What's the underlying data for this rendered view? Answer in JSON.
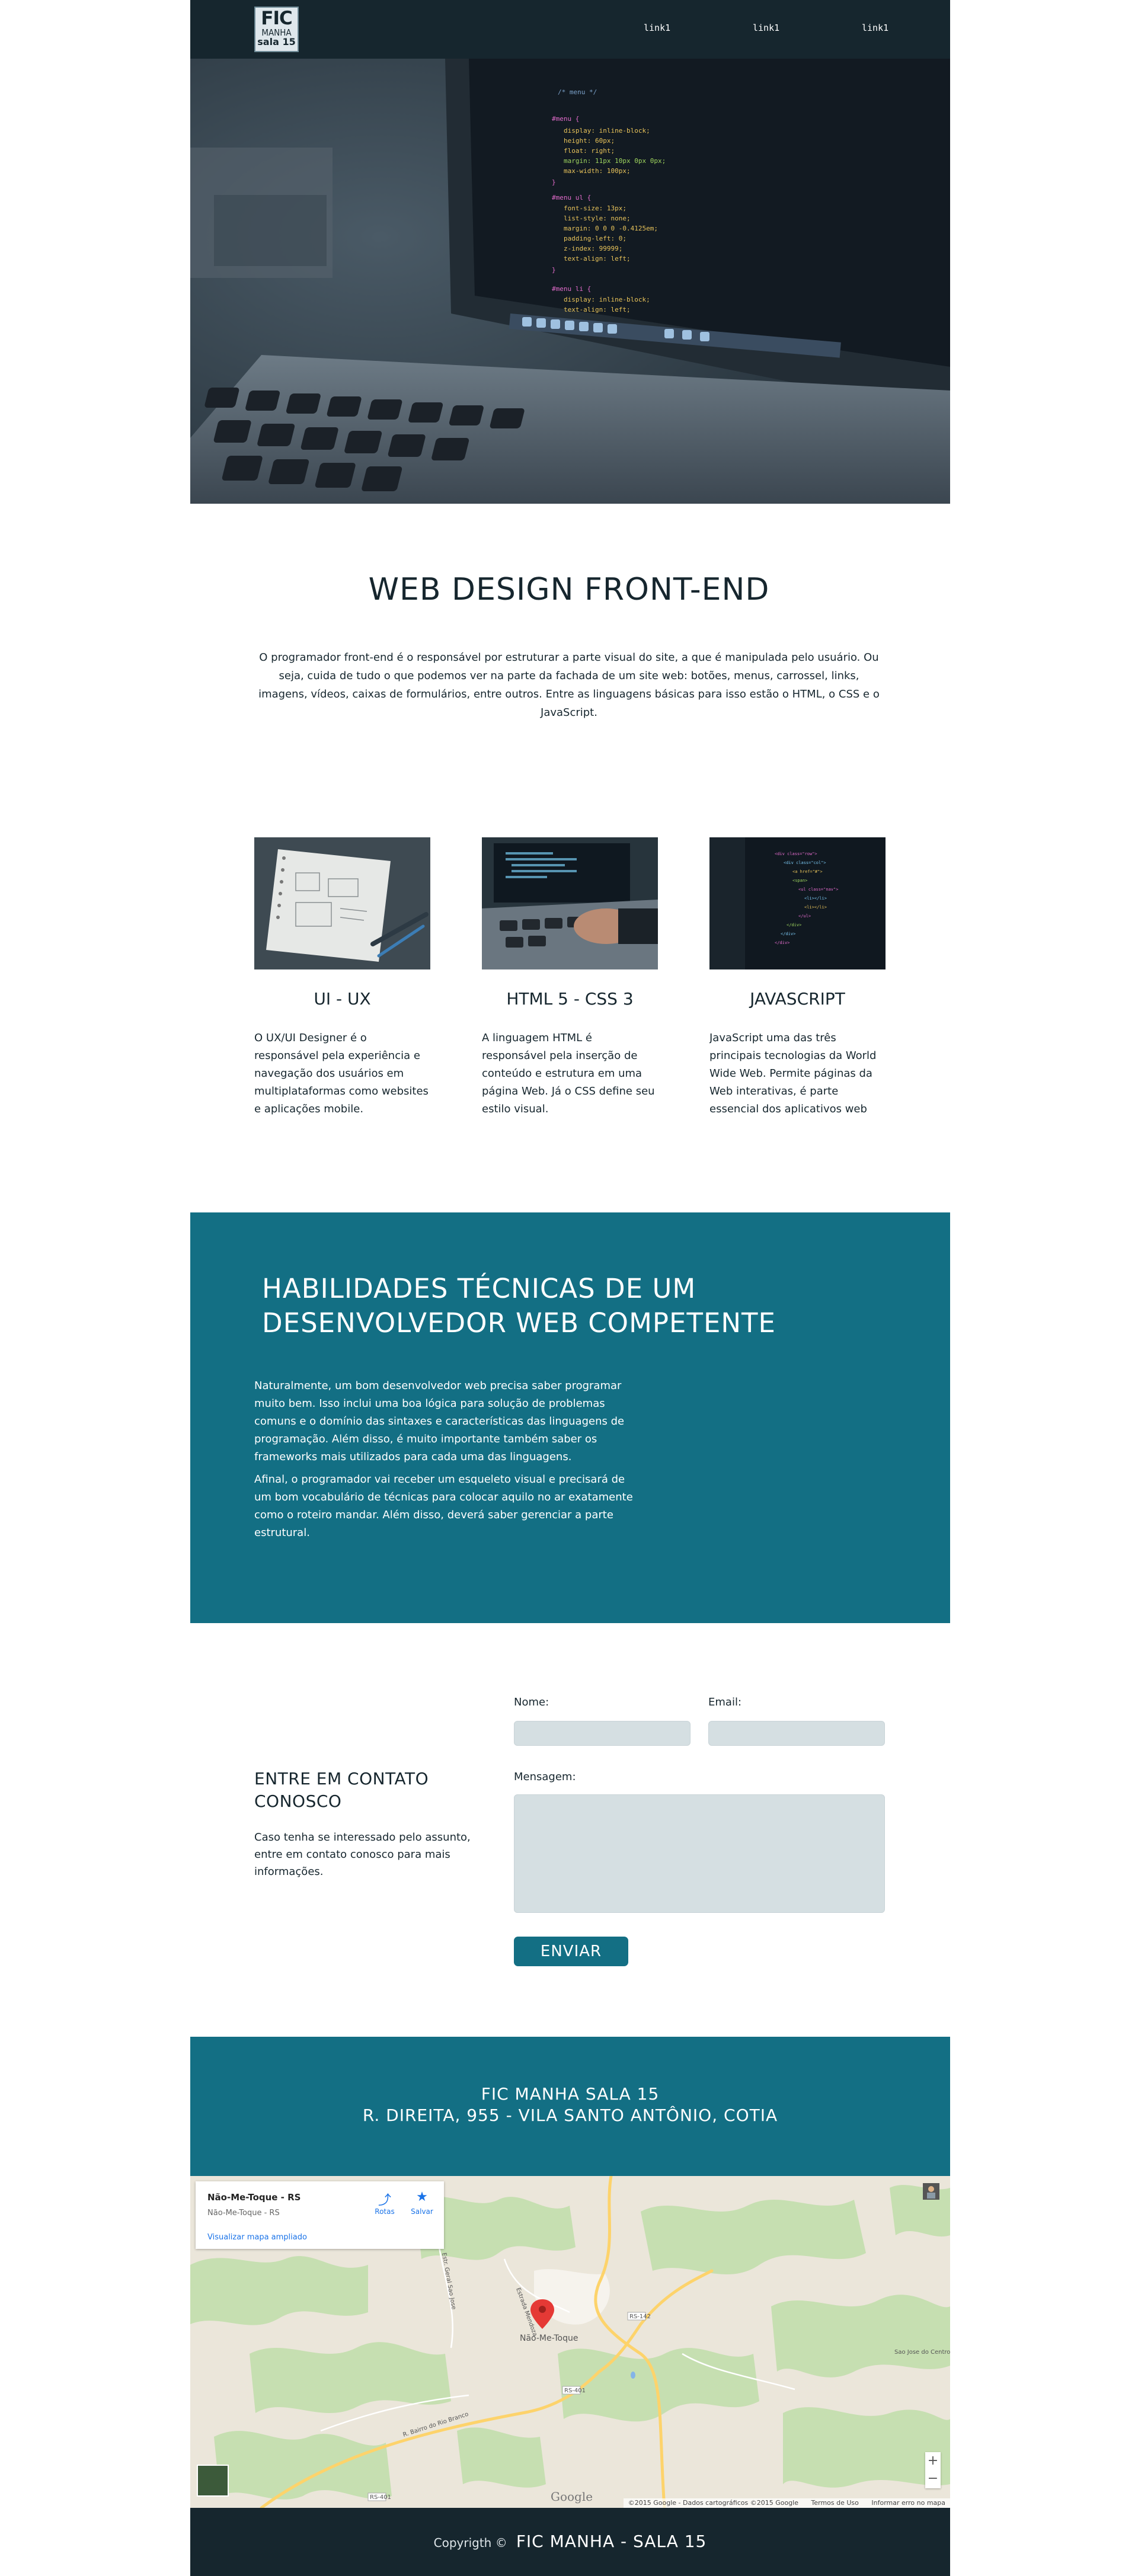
{
  "header": {
    "logo": {
      "line1": "FIC",
      "line2": "MANHA",
      "line3": "sala 15"
    },
    "nav": [
      "link1",
      "link1",
      "link1"
    ]
  },
  "intro": {
    "title": "WEB DESIGN FRONT-END",
    "text": "O programador front-end é o responsável por estruturar a parte visual do site, a que é manipulada pelo usuário. Ou seja, cuida de tudo o que podemos ver na parte da fachada de um site web: botões, menus, carrossel, links, imagens, vídeos, caixas de formulários, entre outros. Entre as linguagens básicas para isso estão o HTML, o CSS e o JavaScript."
  },
  "cards": [
    {
      "title": "UI - UX",
      "text": "O UX/UI Designer é o responsável pela experiência e navegação dos usuários em multiplataformas como websites e aplicações mobile."
    },
    {
      "title": "HTML 5 - CSS 3",
      "text": "A linguagem HTML é responsável pela inserção de conteúdo e estrutura em uma página Web. Já o CSS define seu estilo visual."
    },
    {
      "title": "JAVASCRIPT",
      "text": "JavaScript uma das três principais tecnologias da World Wide Web. Permite páginas da Web interativas, é parte essencial dos aplicativos web"
    }
  ],
  "skills": {
    "title_line1": "HABILIDADES TÉCNICAS DE UM",
    "title_line2": "DESENVOLVEDOR WEB COMPETENTE",
    "p1": "Naturalmente, um bom desenvolvedor web precisa saber programar muito bem. Isso inclui uma boa lógica para solução de problemas comuns e o domínio das sintaxes e características das linguagens de programação. Além disso, é muito importante também saber os frameworks mais utilizados para cada uma das linguagens.",
    "p2": "Afinal, o programador vai receber um esqueleto visual e precisará de um bom vocabulário de técnicas para colocar aquilo no ar exatamente como o roteiro mandar. Além disso, deverá saber gerenciar a parte estrutural."
  },
  "contact": {
    "title_line1": "ENTRE EM CONTATO",
    "title_line2": "CONOSCO",
    "desc": "Caso tenha se interessado pelo assunto, entre em contato conosco para mais informações.",
    "name_label": "Nome:",
    "email_label": "Email:",
    "message_label": "Mensagem:",
    "name_value": "",
    "email_value": "",
    "message_value": "",
    "send_label": "ENVIAR"
  },
  "address": {
    "line1": "FIC MANHA SALA 15",
    "line2": "R. DIREITA, 955 - VILA SANTO ANTÔNIO, COTIA"
  },
  "map": {
    "place_title": "Não-Me-Toque - RS",
    "place_subtitle": "Não-Me-Toque - RS",
    "directions_label": "Rotas",
    "save_label": "Salvar",
    "larger_map_link": "Visualizar mapa ampliado",
    "town_label": "Não-Me-Toque",
    "road_labels": [
      "RS-142",
      "RS-401",
      "RS-401",
      "Sao Jose do Centro"
    ],
    "street_labels": [
      "Estr. Geral Sao Jose",
      "Estrada Mendoza",
      "R. Bairro do Rio Branco"
    ],
    "google_label": "Google",
    "attribution": [
      "©2015 Google - Dados cartográficos ©2015 Google",
      "Termos de Uso",
      "Informar erro no mapa"
    ],
    "zoom_in": "+",
    "zoom_out": "−"
  },
  "footer": {
    "copyright": "Copyrigth ©",
    "name": "FIC MANHA - SALA 15"
  },
  "colors": {
    "dark": "#16262e",
    "teal": "#136f84",
    "field": "#d5dfe2",
    "map_pin": "#e53935"
  }
}
